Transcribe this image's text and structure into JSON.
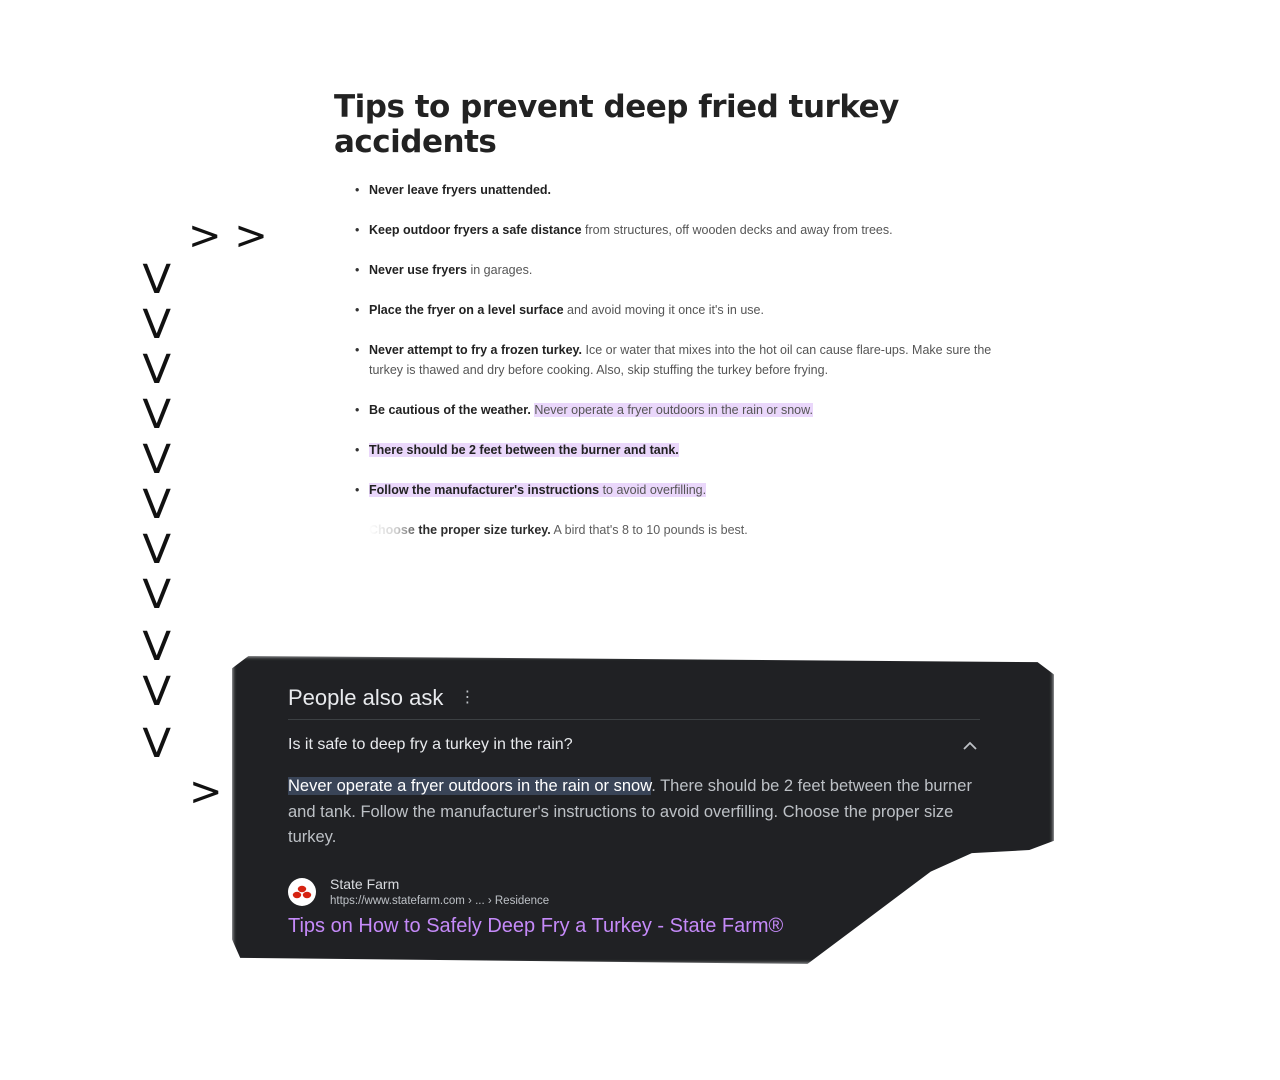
{
  "article": {
    "title": "Tips to prevent deep fried turkey accidents",
    "tips": [
      {
        "bold": "Never leave fryers unattended.",
        "rest": ""
      },
      {
        "bold": "Keep outdoor fryers a safe distance",
        "rest": " from structures, off wooden decks and away from trees."
      },
      {
        "bold": "Never use fryers",
        "rest": " in garages."
      },
      {
        "bold": "Place the fryer on a level surface",
        "rest": " and avoid moving it once it's in use."
      },
      {
        "bold": "Never attempt to fry a frozen turkey.",
        "rest": " Ice or water that mixes into the hot oil can cause flare-ups. Make sure the turkey is thawed and dry before cooking. Also, skip stuffing the turkey before frying."
      },
      {
        "bold": "Be cautious of the weather.",
        "rest_plain": " ",
        "rest_highlighted": "Never operate a fryer outdoors in the rain or snow."
      },
      {
        "bold": "There should be 2 feet between the burner and tank.",
        "rest": ""
      },
      {
        "bold": "Follow the manufacturer's instructions",
        "rest": " to avoid overfilling."
      },
      {
        "bold_faded": "Choose",
        "bold": " the proper size turkey.",
        "rest": " A bird that's 8 to 10 pounds is best."
      }
    ]
  },
  "markers": {
    "double_arrow": "> >",
    "down_arrow": "V",
    "down_arrow_count": 11,
    "single_arrow": ">"
  },
  "paa": {
    "title": "People also ask",
    "menu_icon": "kebab-icon",
    "question": "Is it safe to deep fry a turkey in the rain?",
    "chevron_icon": "chevron-up-icon",
    "answer_selected": "Never operate a fryer outdoors in the rain or snow",
    "answer_rest": ". There should be 2 feet between the burner and tank. Follow the manufacturer's instructions to avoid overfilling. Choose the proper size turkey.",
    "source_name": "State Farm",
    "source_url": "https://www.statefarm.com › ... › Residence",
    "source_icon": "state-farm-logo",
    "link_title": "Tips on How to Safely Deep Fry a Turkey - State Farm®",
    "colors": {
      "background": "#202124",
      "link": "#c58af9",
      "selection": "#394457",
      "highlight": "#ead7fb"
    }
  }
}
